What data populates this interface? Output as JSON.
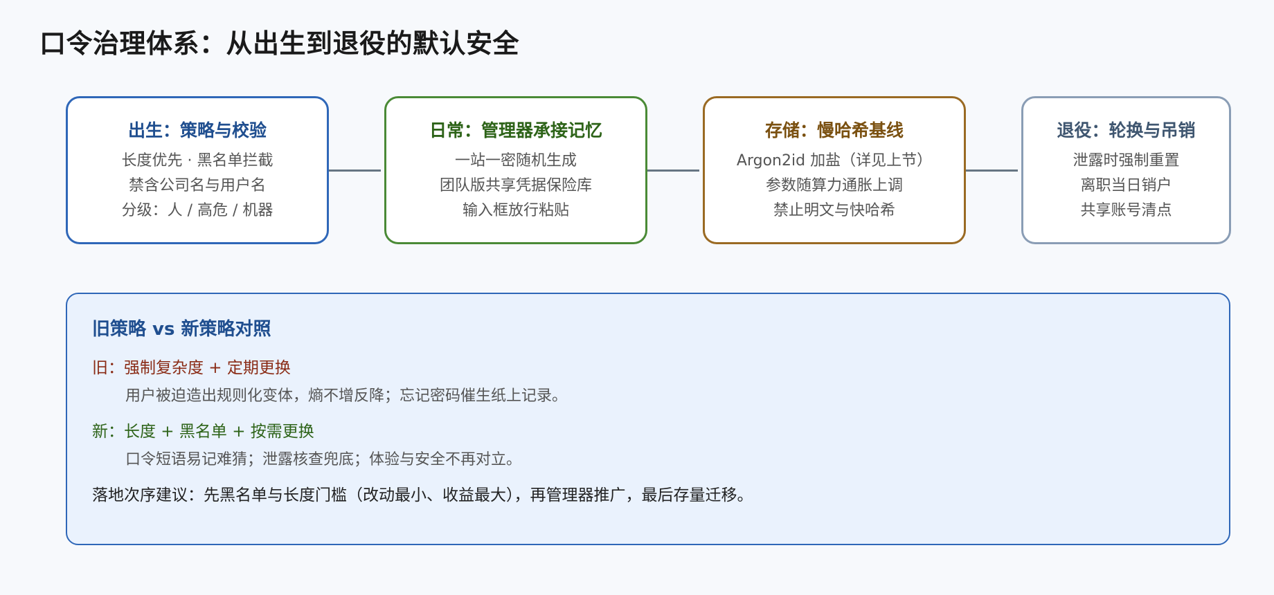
{
  "page_title": "口令治理体系：从出生到退役的默认安全",
  "stages": [
    {
      "title": "出生：策略与校验",
      "color": "#2f67b8",
      "title_color": "#1f4e8f",
      "lines": [
        "长度优先 · 黑名单拦截",
        "禁含公司名与用户名",
        "分级：人 / 高危 / 机器"
      ]
    },
    {
      "title": "日常：管理器承接记忆",
      "color": "#4a8a36",
      "title_color": "#2d6318",
      "lines": [
        "一站一密随机生成",
        "团队版共享凭据保险库",
        "输入框放行粘贴"
      ]
    },
    {
      "title": "存储：慢哈希基线",
      "color": "#9a6a23",
      "title_color": "#7a5010",
      "lines": [
        "Argon2id 加盐（详见上节）",
        "参数随算力通胀上调",
        "禁止明文与快哈希"
      ]
    },
    {
      "title": "退役：轮换与吊销",
      "color": "#8a9db5",
      "title_color": "#3f5670",
      "lines": [
        "泄露时强制重置",
        "离职当日销户",
        "共享账号清点"
      ]
    }
  ],
  "comparison": {
    "title": "旧策略 vs 新策略对照",
    "old_label": "旧：强制复杂度 + 定期更换",
    "old_detail": "用户被迫造出规则化变体，熵不增反降；忘记密码催生纸上记录。",
    "new_label": "新：长度 + 黑名单 + 按需更换",
    "new_detail": "口令短语易记难猜；泄露核查兜底；体验与安全不再对立。",
    "advice": "落地次序建议：先黑名单与长度门槛（改动最小、收益最大），再管理器推广，最后存量迁移。"
  }
}
